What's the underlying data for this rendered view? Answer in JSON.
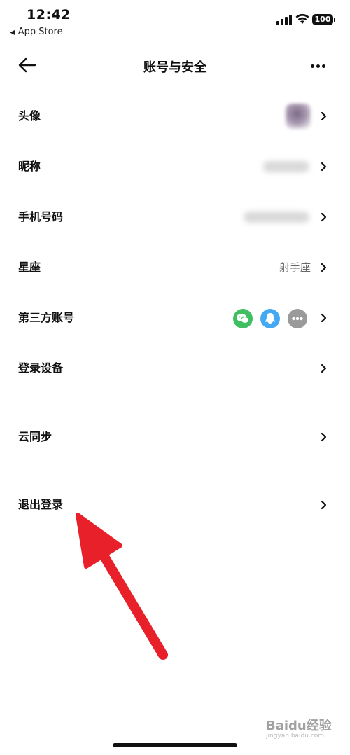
{
  "status_bar": {
    "time": "12:42",
    "back_app": "App Store",
    "battery": "100"
  },
  "nav": {
    "title": "账号与安全"
  },
  "rows": [
    {
      "label": "头像"
    },
    {
      "label": "昵称"
    },
    {
      "label": "手机号码"
    },
    {
      "label": "星座",
      "value": "射手座"
    },
    {
      "label": "第三方账号"
    },
    {
      "label": "登录设备"
    },
    {
      "label": "云同步"
    },
    {
      "label": "退出登录"
    }
  ],
  "third_party_icons": [
    "wechat-icon",
    "qq-icon",
    "more-icon"
  ],
  "annotation": {
    "arrow_color": "#e8202a"
  },
  "watermark": {
    "text": "Baidu经验",
    "sub": "jingyan.baidu.com"
  },
  "colors": {
    "wechat": "#3fbf62",
    "qq": "#44a9f2",
    "more": "#9a9a9a"
  }
}
